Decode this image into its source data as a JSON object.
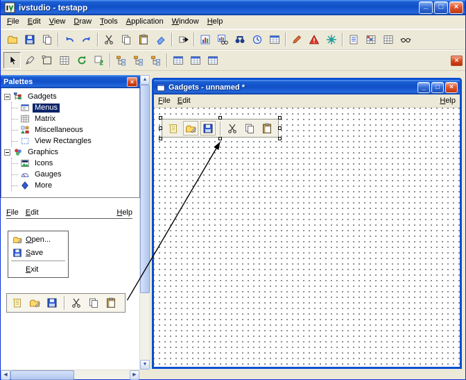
{
  "main_window": {
    "title": "ivstudio - testapp",
    "controls": {
      "minimize": "_",
      "maximize": "□",
      "close": "×"
    }
  },
  "menubar": {
    "items": [
      "File",
      "Edit",
      "View",
      "Draw",
      "Tools",
      "Application",
      "Window",
      "Help"
    ]
  },
  "toolbar_main": {
    "icons": [
      "open",
      "save",
      "copy-page",
      "undo",
      "redo",
      "cut",
      "copy",
      "paste",
      "erase",
      "run",
      "chart",
      "chart-view",
      "binoculars",
      "clock",
      "table",
      "draw-red",
      "alert",
      "gear",
      "notes",
      "grid-colored",
      "grid",
      "glasses"
    ]
  },
  "toolbar_edit": {
    "icons": [
      "pointer",
      "pen",
      "frame",
      "grid-small",
      "refresh",
      "preview-2",
      "hierarchy-1",
      "hierarchy-2",
      "hierarchy-3",
      "table-1",
      "table-2",
      "table-3"
    ],
    "close": "×"
  },
  "palettes": {
    "title": "Palettes",
    "close": "×",
    "tree": [
      {
        "label": "Gadgets",
        "expanded": true,
        "children": [
          {
            "label": "Menus",
            "selected": true
          },
          {
            "label": "Matrix",
            "selected": false
          },
          {
            "label": "Miscellaneous",
            "selected": false
          },
          {
            "label": "View Rectangles",
            "selected": false
          }
        ]
      },
      {
        "label": "Graphics",
        "expanded": true,
        "children": [
          {
            "label": "Icons",
            "selected": false
          },
          {
            "label": "Gauges",
            "selected": false
          },
          {
            "label": "More",
            "selected": false
          }
        ]
      }
    ]
  },
  "preview": {
    "menu": {
      "file": "File",
      "edit": "Edit",
      "help": "Help"
    },
    "dropdown": {
      "open": "Open...",
      "save": "Save",
      "exit": "Exit"
    },
    "toolbar_icons": [
      "new",
      "open",
      "save",
      "cut",
      "copy",
      "paste"
    ]
  },
  "gadgets_window": {
    "title": "Gadgets - unnamed *",
    "controls": {
      "minimize": "_",
      "maximize": "□",
      "close": "×"
    },
    "menu": {
      "file": "File",
      "edit": "Edit",
      "help": "Help"
    },
    "widget_icons": [
      "new",
      "open",
      "save",
      "cut",
      "copy",
      "paste"
    ]
  },
  "scrollbar": {
    "up": "▲",
    "down": "▼",
    "left": "◀",
    "right": "▶"
  },
  "colors": {
    "titlebar_top": "#5A9AF4",
    "titlebar_bottom": "#0B3C9E",
    "selection": "#0A246A",
    "face": "#ECE9D8",
    "window_border": "#0A4FD0",
    "canvas_dot": "#707070"
  }
}
